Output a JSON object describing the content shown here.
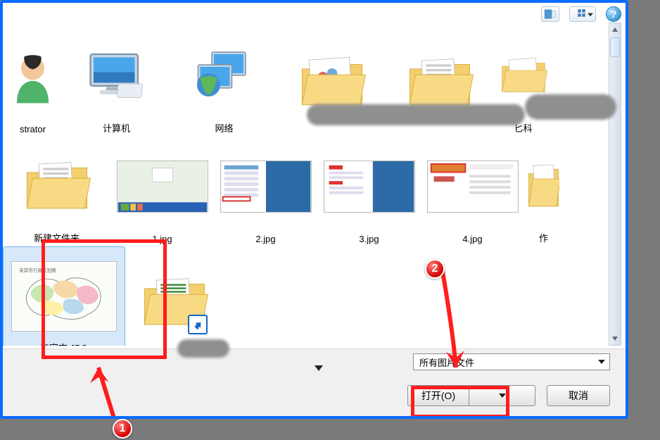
{
  "items_row1": [
    {
      "label": "strator",
      "type": "user"
    },
    {
      "label": "计算机",
      "type": "computer"
    },
    {
      "label": "网络",
      "type": "network"
    },
    {
      "label": "",
      "type": "folder-map"
    },
    {
      "label": "",
      "type": "folder-docs"
    }
  ],
  "items_row2": [
    {
      "label": "匕科",
      "type": "folder-pdf"
    },
    {
      "label": "新建文件夹",
      "type": "folder-docs"
    },
    {
      "label": "1.jpg",
      "type": "thumb-screenshot1"
    },
    {
      "label": "2.jpg",
      "type": "thumb-screenshot2"
    },
    {
      "label": "3.jpg",
      "type": "thumb-screenshot3"
    },
    {
      "label": "4.jpg",
      "type": "thumb-screenshot4"
    }
  ],
  "items_row3": [
    {
      "label": "作",
      "type": "folder-stack"
    },
    {
      "label": "来宾市.JPG",
      "type": "thumb-map",
      "selected": true
    },
    {
      "label": "",
      "type": "folder-docs",
      "shortcut": true
    }
  ],
  "filter": {
    "label": "所有图片文件"
  },
  "buttons": {
    "open": "打开(O)",
    "cancel": "取消"
  },
  "annotations": {
    "badge1": "1",
    "badge2": "2"
  },
  "colors": {
    "accent": "#0a6cff",
    "highlight_box": "#ff1d1d",
    "selection": "#d7e8fb"
  }
}
